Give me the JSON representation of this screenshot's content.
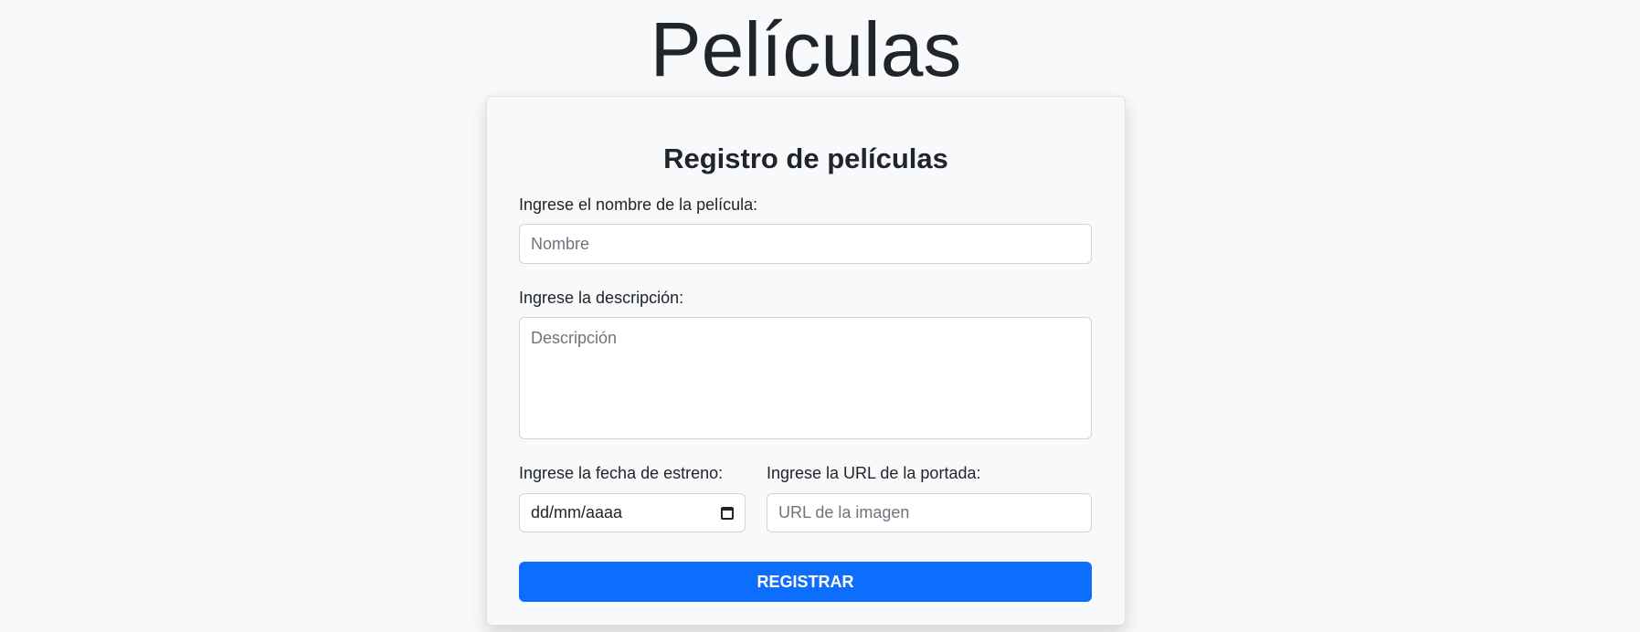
{
  "page": {
    "title": "Películas"
  },
  "form": {
    "heading": "Registro de películas",
    "name_label": "Ingrese el nombre de la película:",
    "name_placeholder": "Nombre",
    "description_label": "Ingrese la descripción:",
    "description_placeholder": "Descripción",
    "date_label": "Ingrese la fecha de estreno:",
    "date_placeholder": "dd/mm/aaaa",
    "url_label": "Ingrese la URL de la portada:",
    "url_placeholder": "URL de la imagen",
    "submit_label": "REGISTRAR"
  },
  "colors": {
    "accent": "#0d6efd",
    "background": "#f8f9fa"
  }
}
